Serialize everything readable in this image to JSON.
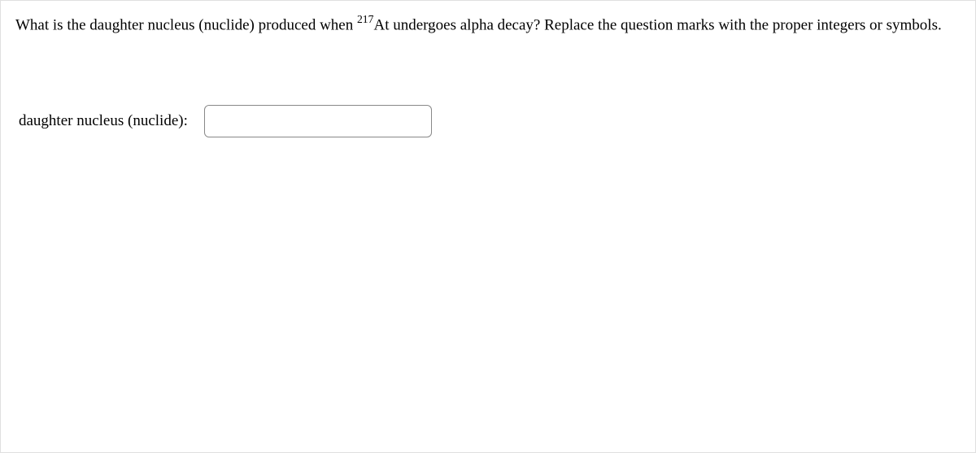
{
  "question": {
    "text_before_sup": "What is the daughter nucleus (nuclide) produced when ",
    "superscript": "217",
    "text_after_sup": "At undergoes alpha decay? Replace the question marks with the proper integers or symbols."
  },
  "answer": {
    "label": "daughter nucleus (nuclide):",
    "value": ""
  }
}
